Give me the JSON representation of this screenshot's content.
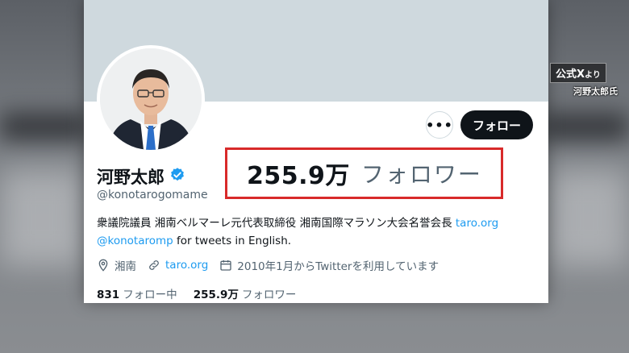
{
  "profile": {
    "display_name": "河野太郎",
    "handle": "@konotarogomame",
    "bio_text": "衆議院議員 湘南ベルマーレ元代表取締役 湘南国際マラソン大会名誉会長 ",
    "bio_link1": "taro.org",
    "bio_mention": "@konotaromp",
    "bio_tail": " for tweets in English.",
    "location": "湘南",
    "website": "taro.org",
    "joined": "2010年1月からTwitterを利用しています",
    "following_count": "831",
    "following_label": "フォロー中",
    "followers_count": "255.9万",
    "followers_label": "フォロワー"
  },
  "buttons": {
    "more": "•••",
    "follow": "フォロー"
  },
  "highlight": {
    "number": "255.9万",
    "label": "フォロワー"
  },
  "source": {
    "main": "公式X",
    "main_small": "より",
    "sub": "河野太郎氏"
  },
  "colors": {
    "accent": "#1d9bf0",
    "highlight_border": "#d82a2a",
    "banner": "#cfd9de"
  },
  "icons": [
    "verified-badge-icon",
    "location-icon",
    "link-icon",
    "calendar-icon"
  ]
}
